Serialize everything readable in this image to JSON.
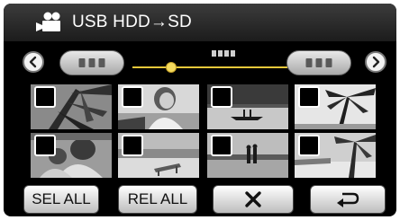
{
  "header": {
    "mode_icon": "video-camera-icon",
    "title": "USB HDD→SD"
  },
  "nav": {
    "prev_icon": "chevron-left-icon",
    "next_icon": "chevron-right-icon",
    "slider_position": 0.25
  },
  "thumbnails": [
    {
      "scene": "palm-leaves",
      "checked": false
    },
    {
      "scene": "woman-portrait",
      "checked": false
    },
    {
      "scene": "canoe-lake",
      "checked": false
    },
    {
      "scene": "palm-silhouette",
      "checked": false
    },
    {
      "scene": "children-playing",
      "checked": false
    },
    {
      "scene": "beach-chair",
      "checked": false
    },
    {
      "scene": "beach-couple",
      "checked": false
    },
    {
      "scene": "palm-beach",
      "checked": false
    }
  ],
  "buttons": {
    "select_all": "SEL ALL",
    "release_all": "REL ALL",
    "close_icon": "close-icon",
    "back_icon": "return-icon"
  }
}
